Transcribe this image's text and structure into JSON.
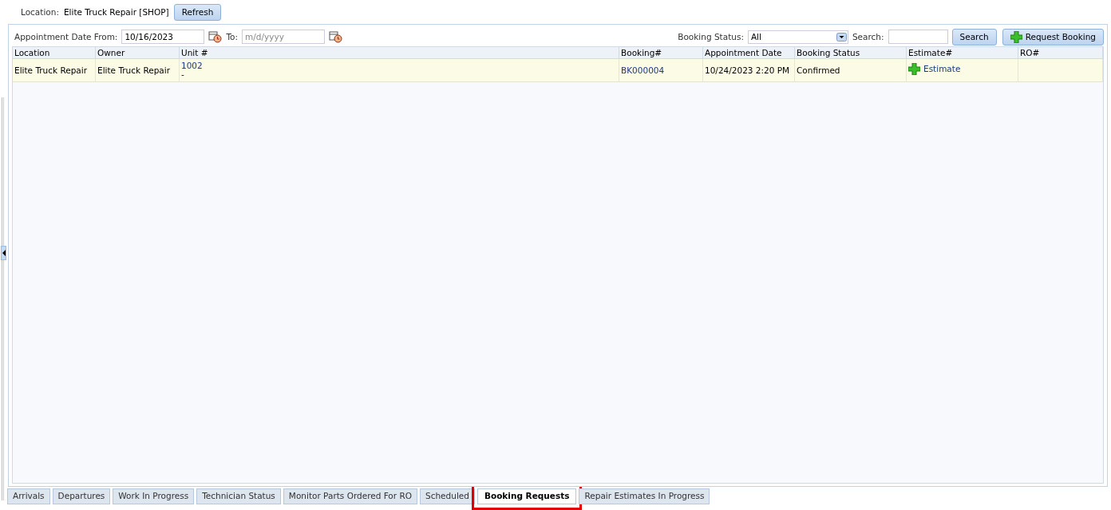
{
  "location": {
    "label": "Location:",
    "value": "Elite Truck Repair [SHOP]",
    "refresh": "Refresh"
  },
  "filters": {
    "from_label": "Appointment Date From:",
    "from_value": "10/16/2023",
    "to_label": "To:",
    "to_placeholder": "m/d/yyyy",
    "status_label": "Booking Status:",
    "status_value": "All",
    "search_label": "Search:",
    "search_button": "Search",
    "request_button": "Request Booking"
  },
  "table": {
    "columns": [
      "Location",
      "Owner",
      "Unit #",
      "Booking#",
      "Appointment Date",
      "Booking Status",
      "Estimate#",
      "RO#"
    ],
    "rows": [
      {
        "location": "Elite Truck Repair",
        "owner": "Elite Truck Repair",
        "unit": "1002",
        "unit_sub": "-",
        "booking": "BK000004",
        "date": "10/24/2023 2:20 PM",
        "status": "Confirmed",
        "estimate": "Estimate",
        "ro": ""
      }
    ]
  },
  "tabs": [
    {
      "label": "Arrivals",
      "selected": false
    },
    {
      "label": "Departures",
      "selected": false
    },
    {
      "label": "Work In Progress",
      "selected": false
    },
    {
      "label": "Technician Status",
      "selected": false
    },
    {
      "label": "Monitor Parts Ordered For RO",
      "selected": false
    },
    {
      "label": "Scheduled",
      "selected": false
    },
    {
      "label": "Booking Requests",
      "selected": true
    },
    {
      "label": "Repair Estimates In Progress",
      "selected": false
    }
  ]
}
